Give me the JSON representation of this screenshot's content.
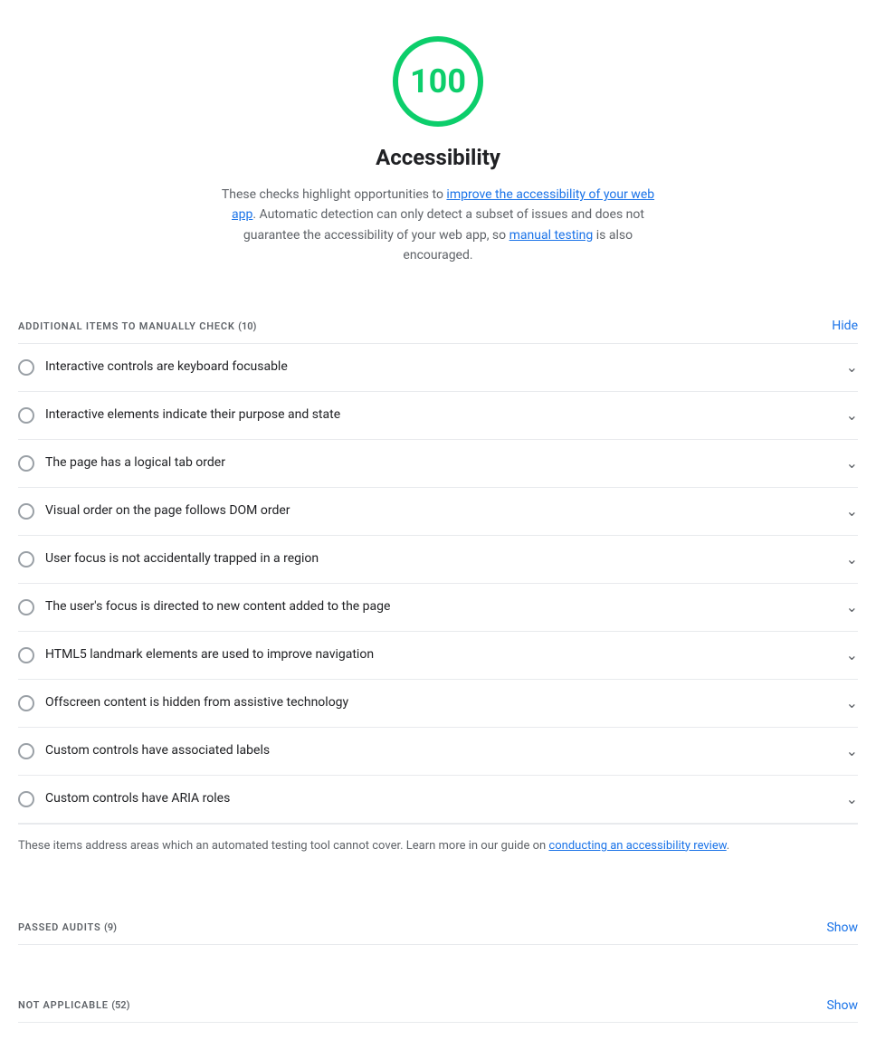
{
  "score": {
    "value": "100",
    "color": "#0cce6b",
    "title": "Accessibility",
    "description_plain": "These checks highlight opportunities to ",
    "link1_text": "improve the accessibility of your web app",
    "link1_href": "#",
    "description_middle": ". Automatic detection can only detect a subset of issues and does not guarantee the accessibility of your web app, so ",
    "link2_text": "manual testing",
    "link2_href": "#",
    "description_end": " is also encouraged."
  },
  "manual_section": {
    "title": "ADDITIONAL ITEMS TO MANUALLY CHECK",
    "count": "(10)",
    "toggle_label": "Hide",
    "items": [
      {
        "label": "Interactive controls are keyboard focusable"
      },
      {
        "label": "Interactive elements indicate their purpose and state"
      },
      {
        "label": "The page has a logical tab order"
      },
      {
        "label": "Visual order on the page follows DOM order"
      },
      {
        "label": "User focus is not accidentally trapped in a region"
      },
      {
        "label": "The user's focus is directed to new content added to the page"
      },
      {
        "label": "HTML5 landmark elements are used to improve navigation"
      },
      {
        "label": "Offscreen content is hidden from assistive technology"
      },
      {
        "label": "Custom controls have associated labels"
      },
      {
        "label": "Custom controls have ARIA roles"
      }
    ],
    "footer_text": "These items address areas which an automated testing tool cannot cover. Learn more in our guide on ",
    "footer_link_text": "conducting an accessibility review",
    "footer_link_href": "#",
    "footer_end": "."
  },
  "passed_section": {
    "title": "PASSED AUDITS",
    "count": "(9)",
    "toggle_label": "Show"
  },
  "not_applicable_section": {
    "title": "NOT APPLICABLE",
    "count": "(52)",
    "toggle_label": "Show"
  }
}
